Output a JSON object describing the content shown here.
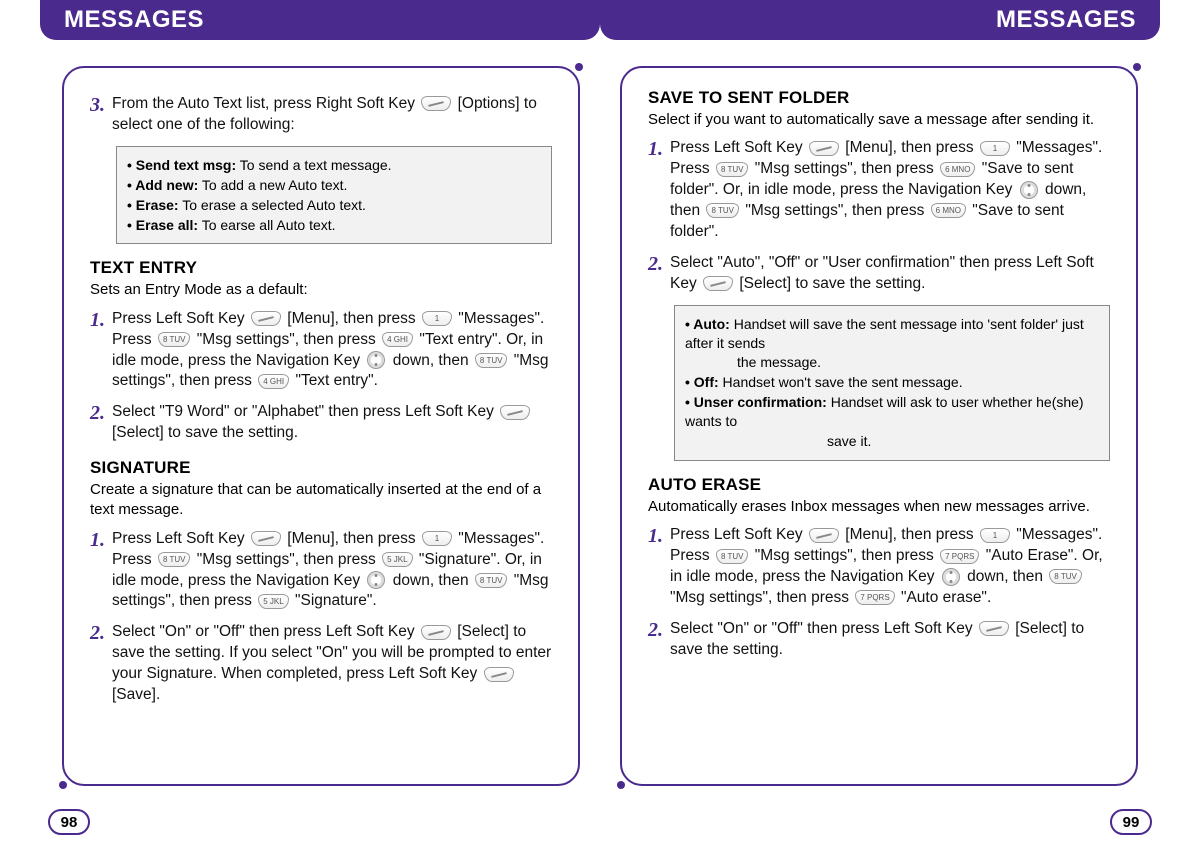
{
  "header": {
    "left": "MESSAGES",
    "right": "MESSAGES"
  },
  "page_left": {
    "step3_pre": "From the Auto Text list, press Right Soft Key ",
    "step3_post": " [Options] to select one of the following:",
    "options": {
      "sendtext_l": "• Send text msg:",
      "sendtext_d": " To send a text message.",
      "addnew_l": "• Add new:",
      "addnew_d": " To add a new Auto text.",
      "erase_l": "• Erase:",
      "erase_d": " To erase a selected Auto text.",
      "eraseall_l": "• Erase all:",
      "eraseall_d": " To earse all Auto text."
    },
    "textentry": {
      "title": "TEXT ENTRY",
      "sub": "Sets an Entry Mode as a default:",
      "s1a": "Press Left Soft Key ",
      "s1b": " [Menu], then press ",
      "s1c": " \"Messages\". Press ",
      "s1d": " \"Msg settings\", then press ",
      "s1e": " \"Text entry\". Or, in idle mode, press the Navigation Key ",
      "s1f": " down, then ",
      "s1g": " \"Msg settings\", then press ",
      "s1h": " \"Text entry\".",
      "s2a": "Select \"T9 Word\" or \"Alphabet\" then press Left Soft Key ",
      "s2b": " [Select] to save the setting."
    },
    "signature": {
      "title": "SIGNATURE",
      "sub": "Create a signature that can be automatically inserted at the end of a text message.",
      "s1a": "Press Left Soft Key ",
      "s1b": " [Menu], then press ",
      "s1c": " \"Messages\". Press ",
      "s1d": " \"Msg settings\", then press ",
      "s1e": " \"Signature\". Or, in idle mode, press the Navigation Key ",
      "s1f": " down, then ",
      "s1g": " \"Msg settings\", then press ",
      "s1h": " \"Signature\".",
      "s2a": "Select \"On\" or \"Off\" then press Left Soft Key ",
      "s2b": " [Select] to save the setting. If you select \"On\" you will be prompted to enter your Signature. When completed, press Left Soft Key ",
      "s2c": " [Save]."
    }
  },
  "page_right": {
    "save": {
      "title": "SAVE TO SENT FOLDER",
      "sub": "Select if you want to automatically save a message after sending it.",
      "s1a": "Press Left Soft Key ",
      "s1b": " [Menu], then press ",
      "s1c": " \"Messages\". Press ",
      "s1d": " \"Msg settings\", then press ",
      "s1e": " \"Save to sent folder\". Or, in idle mode, press the Navigation Key ",
      "s1f": " down, then ",
      "s1g": " \"Msg settings\", then press ",
      "s1h": " \"Save to sent folder\".",
      "s2a": "Select \"Auto\", \"Off\" or \"User confirmation\" then press Left Soft Key ",
      "s2b": " [Select] to save the setting.",
      "opts": {
        "auto_l": "• Auto:",
        "auto_d": " Handset will save the sent message into 'sent folder' just after it sends",
        "auto_d2": "the message.",
        "off_l": "• Off:",
        "off_d": " Handset won't save the sent message.",
        "uc_l": "• Unser confirmation:",
        "uc_d": " Handset will ask to user whether he(she) wants to",
        "uc_d2": "save it."
      }
    },
    "autoerase": {
      "title": "AUTO ERASE",
      "sub": "Automatically erases Inbox messages when new messages arrive.",
      "s1a": "Press Left Soft Key ",
      "s1b": " [Menu], then press ",
      "s1c": " \"Messages\". Press ",
      "s1d": " \"Msg settings\", then press ",
      "s1e": " \"Auto Erase\". Or, in idle mode, press the Navigation Key ",
      "s1f": " down, then ",
      "s1g": " \"Msg settings\", then press ",
      "s1h": " \"Auto erase\".",
      "s2a": "Select \"On\" or \"Off\" then press Left Soft Key ",
      "s2b": " [Select] to save the setting."
    }
  },
  "keys": {
    "k1": "1",
    "k4": "4 GHI",
    "k5": "5 JKL",
    "k6": "6 MNO",
    "k7": "7 PQRS",
    "k8": "8 TUV"
  },
  "nums": {
    "n1": "1.",
    "n2": "2.",
    "n3": "3."
  },
  "pagenums": {
    "left": "98",
    "right": "99"
  }
}
